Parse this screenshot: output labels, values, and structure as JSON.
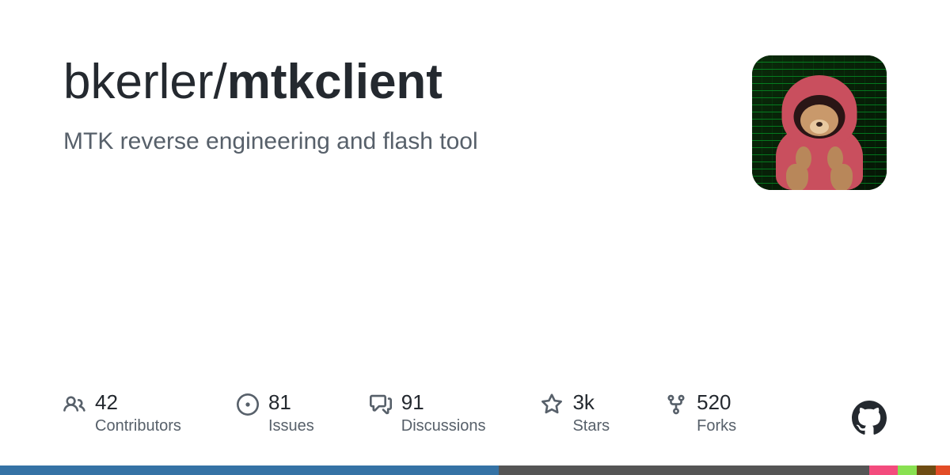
{
  "repo": {
    "owner": "bkerler",
    "slash": "/",
    "name": "mtkclient",
    "description": "MTK reverse engineering and flash tool"
  },
  "stats": {
    "contributors": {
      "value": "42",
      "label": "Contributors"
    },
    "issues": {
      "value": "81",
      "label": "Issues"
    },
    "discussions": {
      "value": "91",
      "label": "Discussions"
    },
    "stars": {
      "value": "3k",
      "label": "Stars"
    },
    "forks": {
      "value": "520",
      "label": "Forks"
    }
  },
  "language_bar": [
    {
      "color": "#3572A5",
      "width": "52.5%"
    },
    {
      "color": "#555555",
      "width": "39%"
    },
    {
      "color": "#f34b7d",
      "width": "3%"
    },
    {
      "color": "#89e051",
      "width": "2%"
    },
    {
      "color": "#6E4C13",
      "width": "2%"
    },
    {
      "color": "#e34c26",
      "width": "1.5%"
    }
  ]
}
